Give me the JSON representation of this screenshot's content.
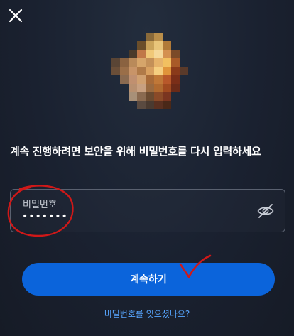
{
  "header": {
    "close_icon": "close-icon"
  },
  "avatar": {
    "icon": "pixelated-profile-photo"
  },
  "prompt": {
    "text": "계속 진행하려면 보안을 위해 비밀번호를 다시 입력하세요"
  },
  "password_field": {
    "label": "비밀번호",
    "value": "•••••••",
    "toggle_icon": "eye-slash-icon"
  },
  "actions": {
    "continue_label": "계속하기",
    "forgot_label": "비밀번호를 잊으셨나요?"
  },
  "annotations": {
    "circle_color": "#d01818",
    "check_color": "#d01818"
  },
  "colors": {
    "accent": "#0b64db",
    "link": "#58a6ff",
    "background": "#1a2130"
  }
}
